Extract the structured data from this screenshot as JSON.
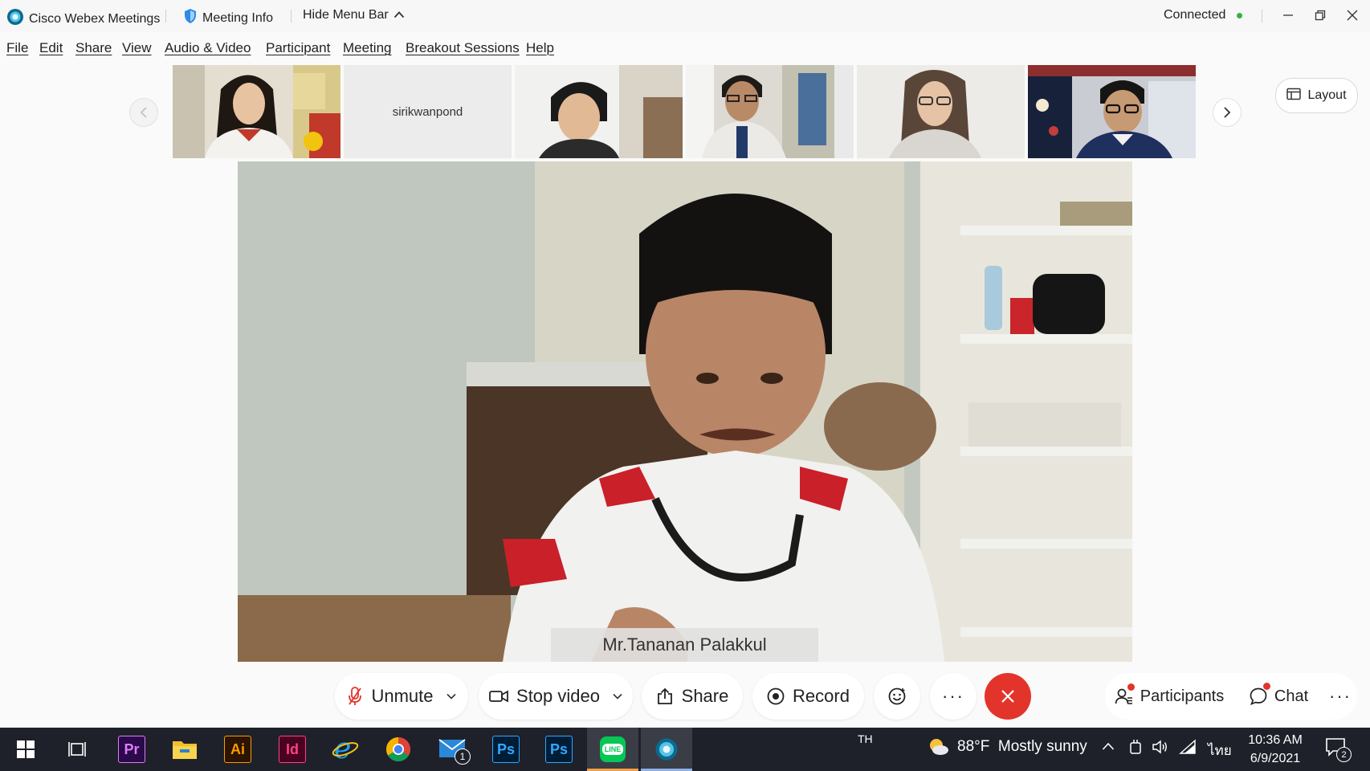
{
  "titlebar": {
    "app_title": "Cisco Webex Meetings",
    "meeting_info": "Meeting Info",
    "hide_menu_bar": "Hide Menu Bar",
    "status": "Connected",
    "status_color": "#2fb344"
  },
  "menu": [
    "File",
    "Edit",
    "Share",
    "View",
    "Audio & Video",
    "Participant",
    "Meeting",
    "Breakout Sessions",
    "Help"
  ],
  "thumbnails": [
    {
      "kind": "video-woman-red"
    },
    {
      "kind": "name-only",
      "name": "sirikwanpond"
    },
    {
      "kind": "video-man-glasses"
    },
    {
      "kind": "video-man-office"
    },
    {
      "kind": "video-woman-glasses"
    },
    {
      "kind": "video-man-poster"
    }
  ],
  "layout_label": "Layout",
  "main_video": {
    "speaker_name": "Mr.Tananan Palakkul"
  },
  "controls": {
    "unmute": "Unmute",
    "stop_video": "Stop video",
    "share": "Share",
    "record": "Record",
    "participants": "Participants",
    "chat": "Chat",
    "end_color": "#e3342b"
  },
  "taskbar": {
    "apps": [
      {
        "name": "premiere",
        "label": "Pr",
        "bg": "#2a0a4a",
        "fg": "#e07cf7"
      },
      {
        "name": "file-explorer",
        "label": "",
        "bg": "",
        "fg": ""
      },
      {
        "name": "illustrator",
        "label": "Ai",
        "bg": "#2b1400",
        "fg": "#ff9a00"
      },
      {
        "name": "indesign",
        "label": "Id",
        "bg": "#49021f",
        "fg": "#ff3f8a"
      },
      {
        "name": "internet-explorer",
        "label": "e",
        "bg": "",
        "fg": "#1ea1f1"
      },
      {
        "name": "chrome",
        "label": "",
        "bg": "",
        "fg": ""
      },
      {
        "name": "mail",
        "label": "1",
        "bg": "",
        "fg": ""
      },
      {
        "name": "photoshop-1",
        "label": "Ps",
        "bg": "#001d36",
        "fg": "#31a8ff"
      },
      {
        "name": "photoshop-2",
        "label": "Ps",
        "bg": "#001d36",
        "fg": "#31a8ff"
      },
      {
        "name": "line",
        "label": "LINE",
        "bg": "#06c755",
        "fg": "#ffffff"
      },
      {
        "name": "webex",
        "label": "",
        "bg": "",
        "fg": ""
      }
    ],
    "lang": "TH",
    "weather": "88°F  Mostly sunny",
    "input_lang": "ไทย",
    "time": "10:36 AM",
    "date": "6/9/2021",
    "notifications": "2"
  }
}
